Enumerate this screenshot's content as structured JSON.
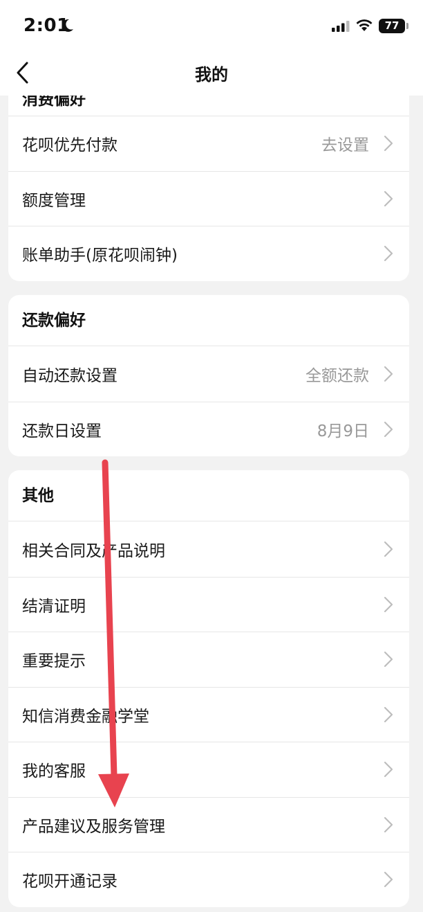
{
  "status_bar": {
    "time": "2:01",
    "battery": "77"
  },
  "nav": {
    "title": "我的"
  },
  "card1": {
    "partial_header": "消费偏好",
    "rows": [
      {
        "label": "花呗优先付款",
        "value": "去设置"
      },
      {
        "label": "额度管理",
        "value": ""
      },
      {
        "label": "账单助手(原花呗闹钟)",
        "value": ""
      }
    ]
  },
  "card2": {
    "header": "还款偏好",
    "rows": [
      {
        "label": "自动还款设置",
        "value": "全额还款"
      },
      {
        "label": "还款日设置",
        "value": "8月9日"
      }
    ]
  },
  "card3": {
    "header": "其他",
    "rows": [
      {
        "label": "相关合同及产品说明"
      },
      {
        "label": "结清证明"
      },
      {
        "label": "重要提示"
      },
      {
        "label": "知信消费金融学堂"
      },
      {
        "label": "我的客服"
      },
      {
        "label": "产品建议及服务管理"
      },
      {
        "label": "花呗开通记录"
      }
    ]
  },
  "colors": {
    "annotation_arrow": "#e8434f",
    "background": "#f2f2f2"
  }
}
